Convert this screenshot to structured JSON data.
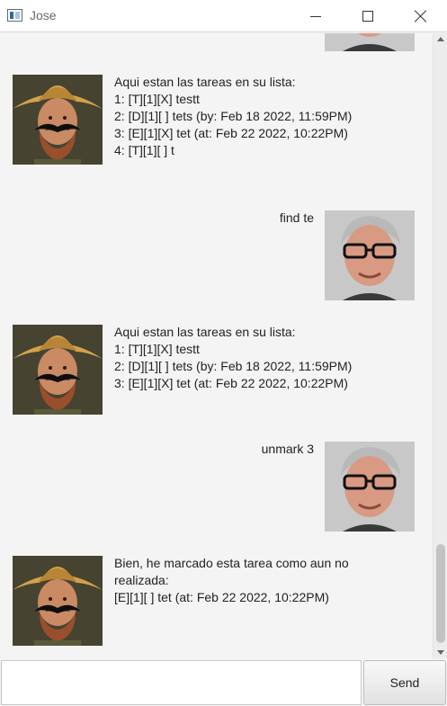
{
  "window": {
    "title": "Jose"
  },
  "messages": [
    {
      "from": "bot",
      "lines": [
        "Aqui estan las tareas en su lista:",
        "1: [T][1][X] testt",
        "2: [D][1][ ] tets (by: Feb 18 2022, 11:59PM)",
        "3: [E][1][X] tet (at: Feb 22 2022, 10:22PM)",
        "4: [T][1][ ] t"
      ]
    },
    {
      "from": "user",
      "text": "find te"
    },
    {
      "from": "bot",
      "lines": [
        "Aqui estan las tareas en su lista:",
        "1: [T][1][X] testt",
        "2: [D][1][ ] tets (by: Feb 18 2022, 11:59PM)",
        "3: [E][1][X] tet (at: Feb 22 2022, 10:22PM)"
      ]
    },
    {
      "from": "user",
      "text": "unmark 3"
    },
    {
      "from": "bot",
      "lines": [
        "Bien, he marcado esta tarea como aun no realizada:",
        "[E][1][ ] tet (at: Feb 22 2022, 10:22PM)"
      ]
    }
  ],
  "input": {
    "value": "",
    "placeholder": ""
  },
  "send_button": {
    "label": "Send"
  },
  "icons": {
    "app": "window-app-icon",
    "minimize": "minimize-icon",
    "maximize": "maximize-icon",
    "close": "close-icon"
  },
  "colors": {
    "background": "#f4f4f4",
    "titlebar": "#ffffff",
    "text": "#222222"
  }
}
